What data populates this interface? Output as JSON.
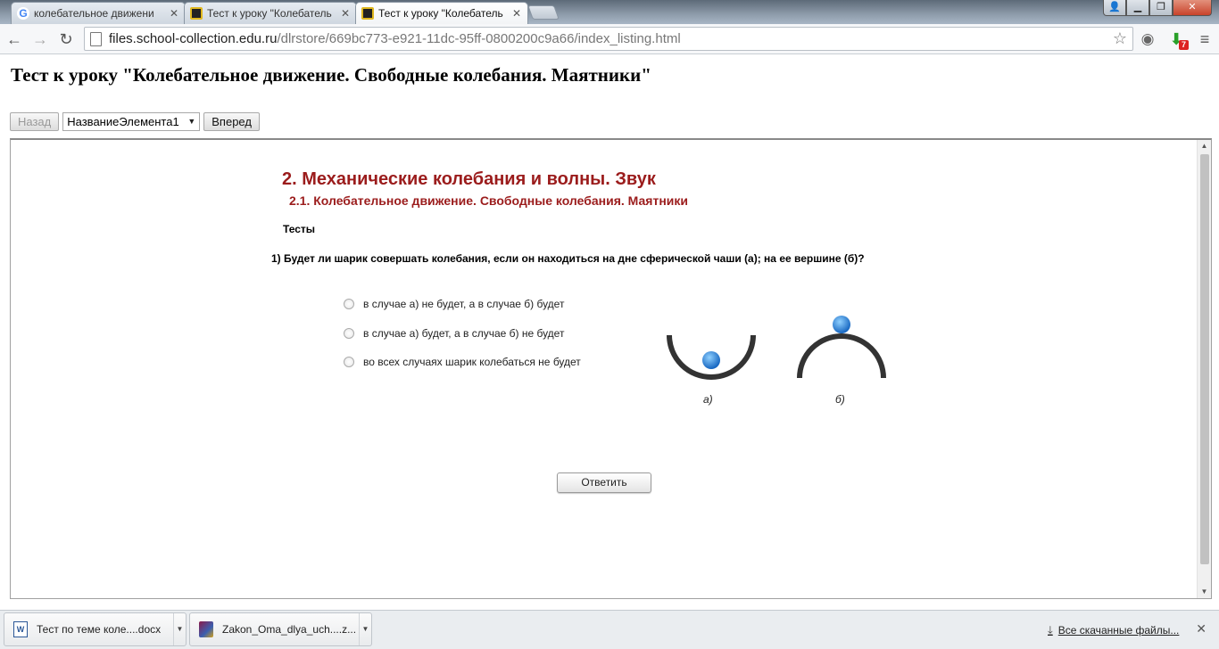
{
  "browser": {
    "tabs": [
      {
        "title": "колебательное движени",
        "favicon": "google-icon"
      },
      {
        "title": "Тест к уроку \"Колебатель",
        "favicon": "page-icon"
      },
      {
        "title": "Тест к уроку \"Колебатель",
        "favicon": "page-icon",
        "active": true
      }
    ],
    "url_host": "files.school-collection.edu.ru",
    "url_path": "/dlrstore/669bc773-e921-11dc-95ff-0800200c9a66/index_listing.html",
    "ext_badge": "7"
  },
  "page": {
    "title": "Тест к уроку \"Колебательное движение. Свободные колебания. Маятники\"",
    "nav": {
      "back_label": "Назад",
      "select_value": "НазваниеЭлемента1",
      "forward_label": "Вперед"
    }
  },
  "content": {
    "section_title": "2. Механические колебания и волны. Звук",
    "subsection_title": "2.1. Колебательное движение. Свободные колебания. Маятники",
    "tests_label": "Тесты",
    "question": "1) Будет ли шарик совершать колебания, если он находиться на дне сферической чаши (а); на ее вершине (б)?",
    "options": [
      "в случае а) не будет, а в случае б) будет",
      "в случае а) будет, а в случае б) не будет",
      "во всех случаях шарик колебаться не будет"
    ],
    "figure_labels": [
      "а)",
      "б)"
    ],
    "answer_label": "Ответить",
    "colors": {
      "heading": "#9b1c1c",
      "ball": "#1e88e5",
      "arc": "#333333"
    }
  },
  "downloads": {
    "items": [
      {
        "name": "Тест по теме коле....docx",
        "icon": "word-doc-icon"
      },
      {
        "name": "Zakon_Oma_dlya_uch....z...",
        "icon": "archive-icon"
      }
    ],
    "all_label": "Все скачанные файлы..."
  }
}
